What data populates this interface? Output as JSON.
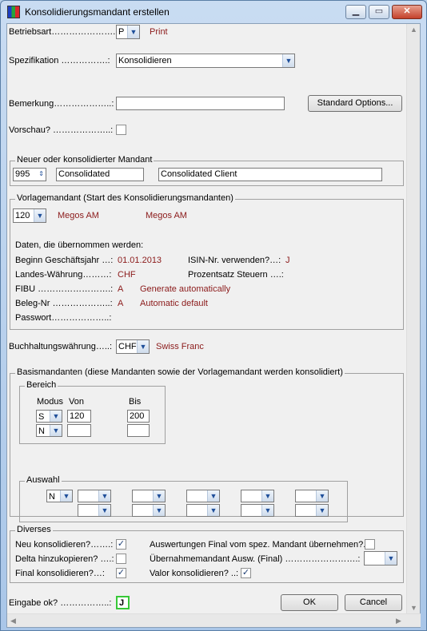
{
  "window": {
    "title": "Konsolidierungsmandant erstellen",
    "minimize": "▁",
    "maximize": "▭",
    "close": "✕"
  },
  "form": {
    "betriebsart_label": "Betriebsart………………….:",
    "betriebsart_value": "P",
    "betriebsart_text": "Print",
    "spezifikation_label": "Spezifikation …………….:",
    "spezifikation_value": "Konsolidieren",
    "bemerkung_label": "Bemerkung………………..:",
    "bemerkung_value": "",
    "standard_options": "Standard Options...",
    "vorschau_label": "Vorschau? ………………..:"
  },
  "neuer_mandant": {
    "legend": "Neuer oder konsolidierter Mandant",
    "number": "995",
    "short_name": "Consolidated",
    "long_name": "Consolidated Client"
  },
  "vorlage": {
    "legend": "Vorlagemandant (Start des Konsolidierungsmandanten)",
    "number": "120",
    "name1": "Megos AM",
    "name2": "Megos AM",
    "daten_label": "Daten, die übernommen werden:",
    "beginn_label": "Beginn Geschäftsjahr …:",
    "beginn_value": "01.01.2013",
    "isin_label": "ISIN-Nr. verwenden?…:",
    "isin_value": "J",
    "landes_label": "Landes-Währung………:",
    "landes_value": "CHF",
    "prozentsatz_label": "Prozentsatz Steuern ….:",
    "fibu_label": "FIBU …………………….:",
    "fibu_value": "A",
    "fibu_text": "Generate automatically",
    "beleg_label": "Beleg-Nr ………………..:",
    "beleg_value": "A",
    "beleg_text": "Automatic default",
    "passwort_label": "Passwort………………..:"
  },
  "buchhaltung": {
    "label": "Buchhaltungswährung…..:",
    "value": "CHF",
    "text": "Swiss Franc"
  },
  "basis": {
    "legend": "Basismandanten (diese Mandanten sowie der Vorlagemandant werden konsolidiert)",
    "bereich_legend": "Bereich",
    "col_modus": "Modus",
    "col_von": "Von",
    "col_bis": "Bis",
    "row1_modus": "S",
    "row1_von": "120",
    "row1_bis": "200",
    "row2_modus": "N",
    "auswahl_legend": "Auswahl",
    "auswahl_first": "N"
  },
  "diverses": {
    "legend": "Diverses",
    "neu_label": "Neu konsolidieren?…….:",
    "delta_label": "Delta hinzukopieren? ….:",
    "final_label": "Final konsolidieren?…:",
    "auswertungen_label": "Auswertungen Final vom spez. Mandant übernehmen?.:",
    "uebernahme_label": "Übernahmemandant Ausw. (Final) …………………….:",
    "valor_label": "Valor konsolidieren? ..:",
    "check_mark": "✓"
  },
  "footer": {
    "eingabe_label": "Eingabe ok? ……………..:",
    "eingabe_value": "J",
    "ok": "OK",
    "cancel": "Cancel"
  }
}
